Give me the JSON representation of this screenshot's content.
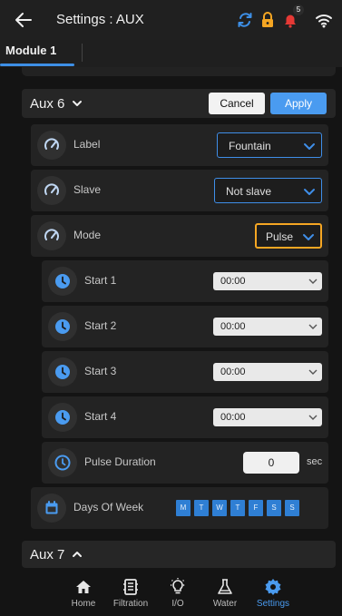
{
  "header": {
    "title": "Settings : AUX",
    "notification_count": "5",
    "icons": [
      "back-arrow-icon",
      "sync-icon",
      "lock-icon",
      "bell-icon",
      "wifi-icon"
    ],
    "colors": {
      "sync": "#3d8fe6",
      "lock": "#f5a623",
      "bell": "#e53935"
    }
  },
  "tabs": [
    {
      "label": "Module 1",
      "active": true
    }
  ],
  "aux6": {
    "label": "Aux 6",
    "cancel_label": "Cancel",
    "apply_label": "Apply",
    "label_row": {
      "label": "Label",
      "value": "Fountain"
    },
    "slave_row": {
      "label": "Slave",
      "value": "Not slave"
    },
    "mode_row": {
      "label": "Mode",
      "value": "Pulse"
    },
    "starts": [
      {
        "label": "Start 1",
        "value": "00:00"
      },
      {
        "label": "Start 2",
        "value": "00:00"
      },
      {
        "label": "Start 3",
        "value": "00:00"
      },
      {
        "label": "Start 4",
        "value": "00:00"
      }
    ],
    "pulse_duration": {
      "label": "Pulse Duration",
      "value": "0",
      "unit": "sec"
    },
    "days_of_week": {
      "label": "Days Of Week",
      "days": [
        "M",
        "T",
        "W",
        "T",
        "F",
        "S",
        "S"
      ]
    }
  },
  "aux7": {
    "label": "Aux 7"
  },
  "nav": [
    {
      "label": "Home",
      "icon": "home-icon"
    },
    {
      "label": "Filtration",
      "icon": "filtration-icon"
    },
    {
      "label": "I/O",
      "icon": "lightbulb-icon"
    },
    {
      "label": "Water",
      "icon": "flask-icon"
    },
    {
      "label": "Settings",
      "icon": "gear-icon",
      "active": true
    }
  ],
  "accent_color": "#4a9bf0"
}
